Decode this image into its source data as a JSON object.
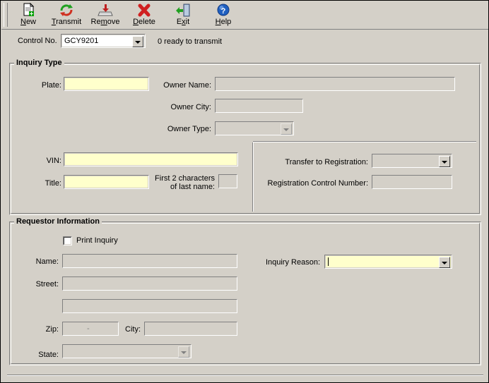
{
  "window": {
    "background_color": "#d4d0c8",
    "field_highlight_color": "#ffffcc"
  },
  "toolbar": {
    "buttons": [
      {
        "label_prefix": "",
        "label_underline": "N",
        "label_suffix": "ew",
        "label": "New",
        "icon": "new-document-icon"
      },
      {
        "label_prefix": "",
        "label_underline": "T",
        "label_suffix": "ransmit",
        "label": "Transmit",
        "icon": "transmit-refresh-icon"
      },
      {
        "label_prefix": "Re",
        "label_underline": "m",
        "label_suffix": "ove",
        "label": "Remove",
        "icon": "remove-inbox-icon"
      },
      {
        "label_prefix": "",
        "label_underline": "D",
        "label_suffix": "elete",
        "label": "Delete",
        "icon": "delete-x-icon"
      },
      {
        "label_prefix": "E",
        "label_underline": "x",
        "label_suffix": "it",
        "label": "Exit",
        "icon": "exit-door-icon"
      },
      {
        "label_prefix": "",
        "label_underline": "H",
        "label_suffix": "elp",
        "label": "Help",
        "icon": "help-question-icon"
      }
    ]
  },
  "control_row": {
    "label": "Control No.",
    "value": "GCY9201",
    "status": "0 ready to transmit"
  },
  "inquiry_type": {
    "title": "Inquiry Type",
    "plate_label": "Plate:",
    "plate_value": "",
    "owner_name_label": "Owner Name:",
    "owner_name_value": "",
    "owner_city_label": "Owner City:",
    "owner_city_value": "",
    "owner_type_label": "Owner Type:",
    "owner_type_value": "",
    "vin_label": "VIN:",
    "vin_value": "",
    "title_label": "Title:",
    "title_value": "",
    "first2_label_line1": "First 2 characters",
    "first2_label_line2": "of last name:",
    "first2_value": "",
    "transfer_label": "Transfer to Registration:",
    "transfer_value": "",
    "reg_control_label": "Registration Control Number:",
    "reg_control_value": ""
  },
  "requestor_information": {
    "title": "Requestor Information",
    "print_inquiry_label": "Print Inquiry",
    "print_inquiry_checked": false,
    "name_label": "Name:",
    "name_value": "",
    "street_label": "Street:",
    "street_value": "",
    "street2_value": "",
    "zip_label": "Zip:",
    "zip_value": "",
    "zip_separator": "-",
    "city_label": "City:",
    "city_value": "",
    "state_label": "State:",
    "state_value": "",
    "inquiry_reason_label": "Inquiry Reason:",
    "inquiry_reason_value": ""
  }
}
